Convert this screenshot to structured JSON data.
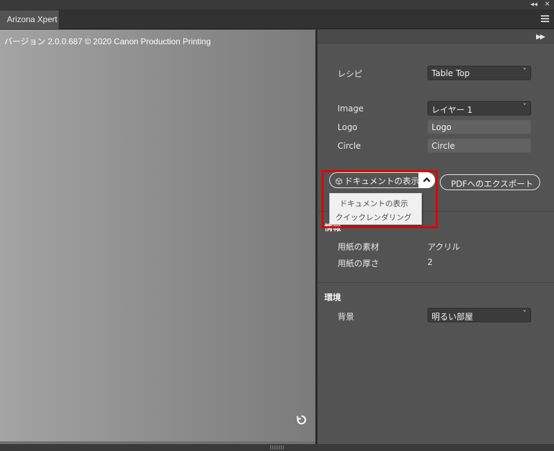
{
  "window": {
    "collapse_glyph": "◂◂",
    "close_glyph": "✕"
  },
  "tab": {
    "title": "Arizona Xpert"
  },
  "preview": {
    "version_text": "バージョン 2.0.0.687 © 2020 Canon Production Printing"
  },
  "panel": {
    "expand_glyph": "▶▶",
    "recipe": {
      "label": "レシピ",
      "value": "Table Top"
    },
    "image": {
      "label": "Image",
      "value": "レイヤー 1"
    },
    "logo": {
      "label": "Logo",
      "value": "Logo"
    },
    "circle": {
      "label": "Circle",
      "value": "Circle"
    },
    "view_button": {
      "label": "ドキュメントの表示"
    },
    "export_button": {
      "label": "PDFへのエクスポート"
    },
    "view_menu": {
      "items": [
        "ドキュメントの表示",
        "クイックレンダリング"
      ]
    },
    "media": {
      "title": "情報",
      "material_label": "用紙の素材",
      "material_value": "アクリル",
      "thickness_label": "用紙の厚さ",
      "thickness_value": "2"
    },
    "environment": {
      "title": "環境",
      "background_label": "背景",
      "background_value": "明るい部屋"
    }
  },
  "colors": {
    "panel_bg": "#535353",
    "highlight": "#e00000",
    "dropdown_bg": "#f0f0f0"
  },
  "icons": [
    "collapse-icon",
    "close-icon",
    "panel-menu-icon",
    "expand-icon",
    "refresh-icon",
    "cube-icon",
    "caret-up-icon",
    "chevron-down-icon"
  ]
}
